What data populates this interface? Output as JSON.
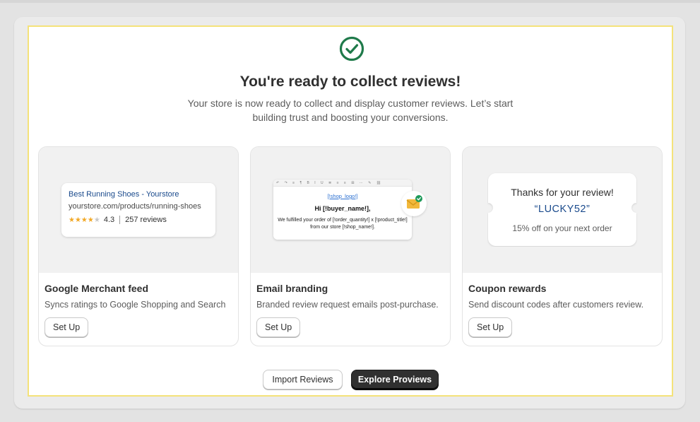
{
  "header": {
    "title": "You're ready to collect reviews!",
    "subtitle": "Your store is now ready to collect and display customer reviews. Let’s start building trust and boosting your conversions."
  },
  "colors": {
    "success": "#1f7a4a",
    "primary_button": "#303030",
    "highlight_border": "#f4e27a",
    "link": "#1a4a8c",
    "star": "#f2a825"
  },
  "cards": [
    {
      "title": "Google Merchant feed",
      "description": "Syncs ratings to Google Shopping and Search",
      "button_label": "Set Up",
      "preview": {
        "link_text": "Best Running Shoes - Yourstore",
        "url": "yourstore.com/products/running-shoes",
        "rating": "4.3",
        "stars_filled": 4,
        "reviews": "257 reviews"
      }
    },
    {
      "title": "Email branding",
      "description": "Branded review request emails post-purchase.",
      "button_label": "Set Up",
      "preview": {
        "toolbar_icons": "↶ ↷ ≡ ¶ B I U ≣ ≡ ≡ ⊞ ⋯ ✎ ⛓",
        "logo_placeholder": "[!shop_logo!]",
        "greeting": "Hi [!buyer_name!],",
        "body": "We fulfilled your order of [!order_quantity!] x [!product_title!] from our store [!shop_name!].",
        "badge_icon": "mail-check-icon"
      }
    },
    {
      "title": "Coupon rewards",
      "description": "Send discount codes after customers review.",
      "button_label": "Set Up",
      "preview": {
        "thanks": "Thanks for your review!",
        "code": "“LUCKY52”",
        "offer": "15% off on your next order"
      }
    }
  ],
  "actions": {
    "import_label": "Import Reviews",
    "explore_label": "Explore Proviews"
  }
}
